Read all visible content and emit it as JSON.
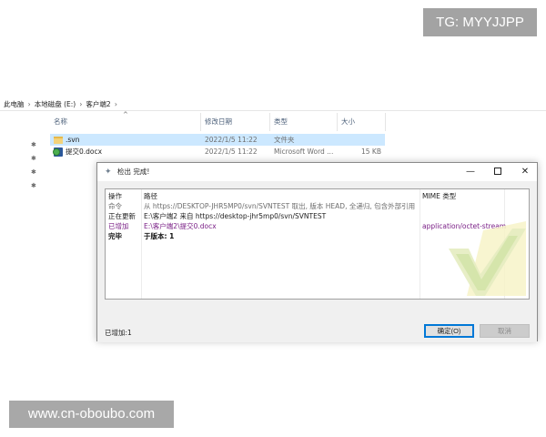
{
  "watermarks": {
    "top": "TG: MYYJJPP",
    "bottom": "www.cn-oboubo.com"
  },
  "explorer": {
    "breadcrumb": [
      "此电脑",
      "本地磁盘 (E:)",
      "客户端2"
    ],
    "columns": {
      "name": "名称",
      "modified": "修改日期",
      "type": "类型",
      "size": "大小"
    },
    "files": [
      {
        "name": ".svn",
        "modified": "2022/1/5 11:22",
        "type": "文件夹",
        "size": "",
        "icon": "folder-icon"
      },
      {
        "name": "提交0.docx",
        "modified": "2022/1/5 11:22",
        "type": "Microsoft Word ...",
        "size": "15 KB",
        "icon": "docx-svn-added-icon"
      }
    ]
  },
  "dialog": {
    "title": "检出 完成!",
    "window_buttons": {
      "minimize": "—",
      "close": "✕"
    },
    "log": {
      "headers": {
        "action": "操作",
        "path": "路径",
        "mime": "MIME 类型"
      },
      "rows": [
        {
          "action": "命令",
          "path": "从 https://DESKTOP-JHR5MP0/svn/SVNTEST 取出, 版本 HEAD, 全递归, 包含外部引用",
          "mime": "",
          "color": "#6d6d6d",
          "bold": false
        },
        {
          "action": "正在更新",
          "path": "E:\\客户端2 来自 https://desktop-jhr5mp0/svn/SVNTEST",
          "mime": "",
          "color": "#222222",
          "bold": false
        },
        {
          "action": "已增加",
          "path": "E:\\客户端2\\提交0.docx",
          "mime": "application/octet-stream",
          "color": "#7a1f86",
          "bold": false
        },
        {
          "action": "完毕",
          "path": "于版本: 1",
          "mime": "",
          "color": "#111111",
          "bold": true
        }
      ]
    },
    "status": "已增加:1",
    "buttons": {
      "ok": "确定(O)",
      "cancel": "取消"
    }
  },
  "colors": {
    "selection": "#cce8ff",
    "added": "#7a1f86",
    "accent": "#0078d7"
  }
}
